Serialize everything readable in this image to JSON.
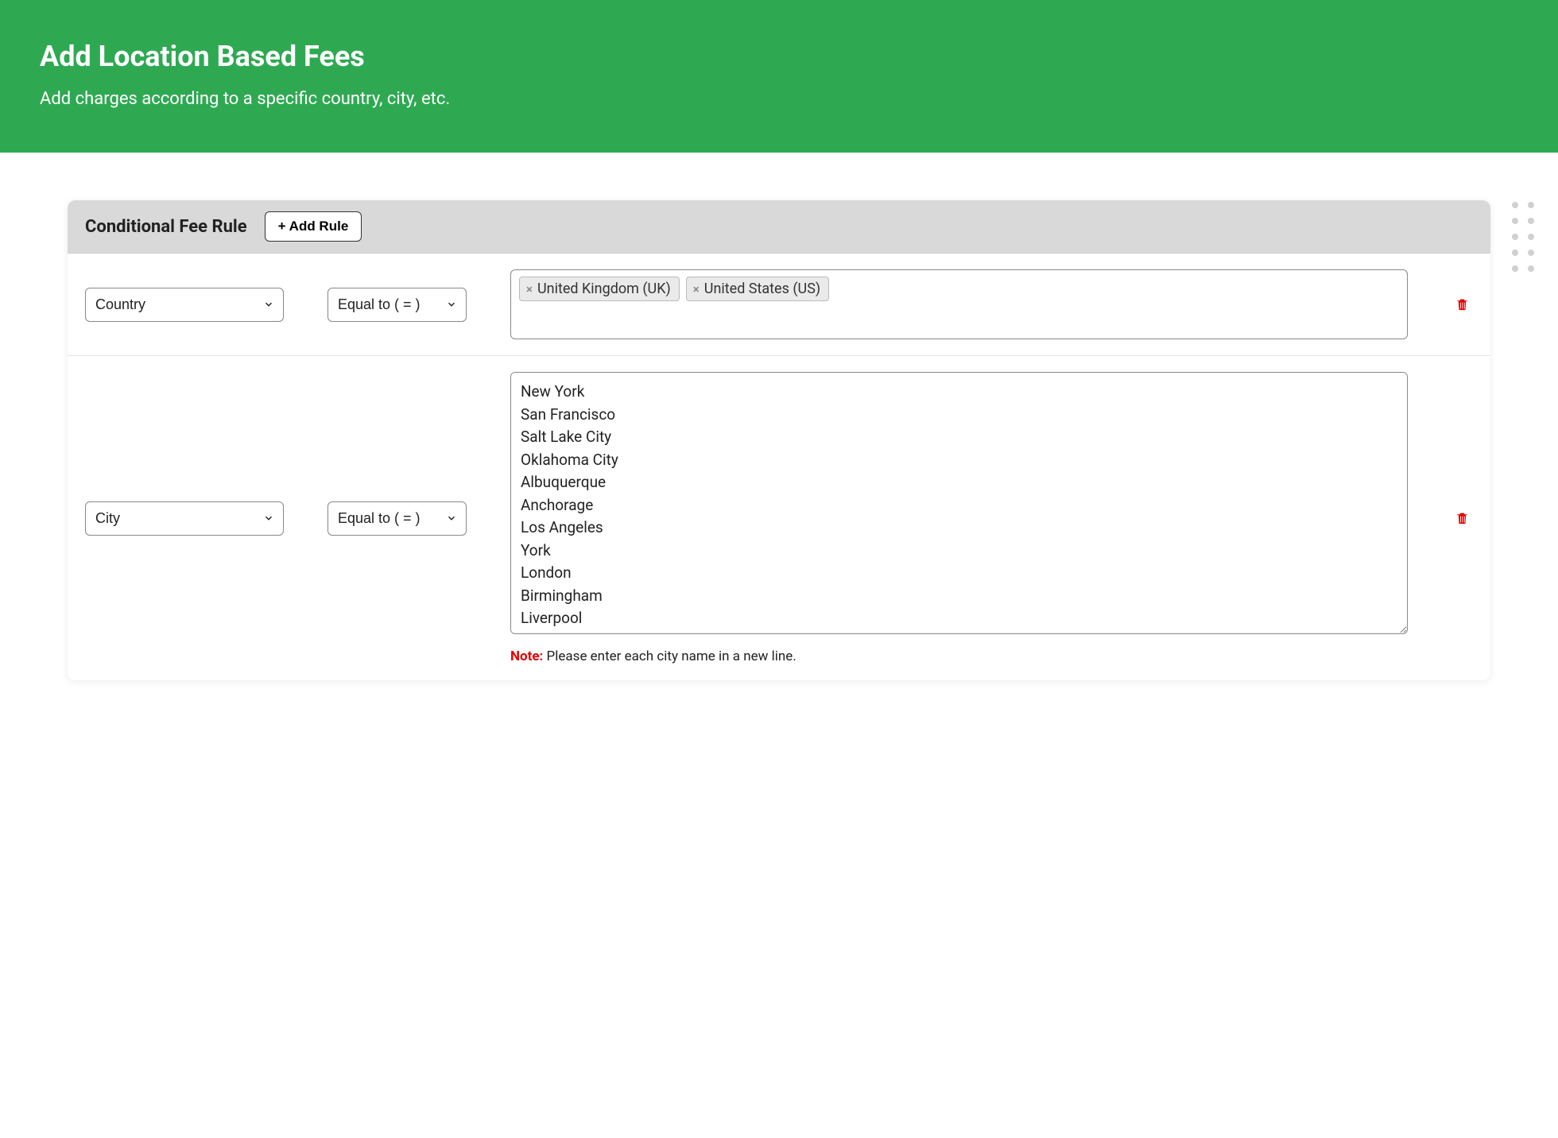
{
  "header": {
    "title": "Add Location Based Fees",
    "subtitle": "Add charges according to a specific country, city, etc."
  },
  "card": {
    "title": "Conditional Fee Rule",
    "add_rule_label": "+ Add Rule"
  },
  "rules": [
    {
      "field": "Country",
      "operator": "Equal to ( = )",
      "tags": [
        "United Kingdom (UK)",
        "United States (US)"
      ]
    },
    {
      "field": "City",
      "operator": "Equal to ( = )",
      "textarea": "New York\nSan Francisco\nSalt Lake City\nOklahoma City\nAlbuquerque\nAnchorage\nLos Angeles\nYork\nLondon\nBirmingham\nLiverpool\nDerby",
      "note_label": "Note:",
      "note_text": " Please enter each city name in a new line."
    }
  ]
}
